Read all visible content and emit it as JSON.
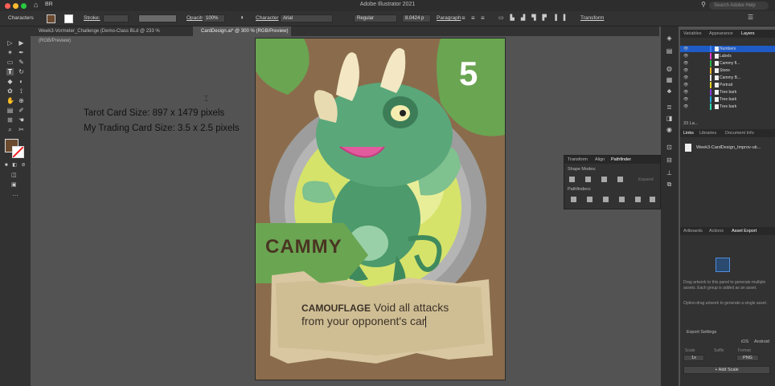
{
  "app": {
    "title": "Adobe Illustrator 2021",
    "menu_label": "BR",
    "search_placeholder": "Search Adobe Help"
  },
  "control_bar": {
    "label": "Characters",
    "stroke_label": "Stroke:",
    "opacity_label": "Opacity:",
    "opacity_value": "100%",
    "character_label": "Character",
    "font_value": "Arial",
    "style_value": "Regular",
    "size_value": "8.0424 p",
    "paragraph_label": "Paragraph",
    "transform_label": "Transform"
  },
  "doc_tabs": [
    {
      "label": "Week3-Vormeter_Challenge (Demo-Class BLd @ 233 % (RGB/Preview)",
      "active": false
    },
    {
      "label": "CardDesign.ai* @ 300 % (RGB/Preview)",
      "active": true
    }
  ],
  "canvas_notes": {
    "line1": "Tarot Card Size: 897 x 1479 pixels",
    "line2": "My Trading Card Size: 3.5 x 2.5 pixels"
  },
  "card": {
    "number": "5",
    "name": "CAMMY",
    "ability_name": "CAMOUFLAGE",
    "ability_text_1": "Void all attacks",
    "ability_text_2": "from your opponent's car"
  },
  "layers_panel": {
    "tabs": [
      "Variables",
      "Appearance",
      "Layers"
    ],
    "layers": [
      "Numbers",
      "Labels",
      "Cammy fl...",
      "Stone",
      "Cammy B...",
      "Portrait",
      "Tree bark",
      "Tree bark",
      "Tree bark"
    ],
    "layer_colors": [
      "#3d7ff0",
      "#e43ad1",
      "#2bb24c",
      "#e8b22b",
      "#e8e8e8",
      "#e3d324",
      "#8a3be3",
      "#1ea8d8",
      "#2bd8b0"
    ],
    "footer": "33 La..."
  },
  "links_panel": {
    "tabs": [
      "Links",
      "Libraries",
      "Document Info"
    ],
    "file": "Week3-CardDesign_Improv-ub..."
  },
  "asset_panel": {
    "tabs": [
      "Artboards",
      "Actions",
      "Asset Export"
    ],
    "help1": "Drag artwork to this panel to generate multiple assets. Each group is added as an asset.",
    "help2": "Option-drag artwork to generate a single asset.",
    "export_settings": "Export Settings",
    "ios": "iOS",
    "android": "Android",
    "scale_label": "Scale",
    "suffix_label": "Suffix",
    "format_label": "Format",
    "scale_value": "1x",
    "format_value": "PNG",
    "add_scale": "+ Add Scale"
  },
  "pathfinder_panel": {
    "tabs": [
      "Transform",
      "Align",
      "Pathfinder"
    ],
    "shape_modes": "Shape Modes:",
    "pathfinders": "Pathfinders:",
    "expand": "Expand"
  }
}
